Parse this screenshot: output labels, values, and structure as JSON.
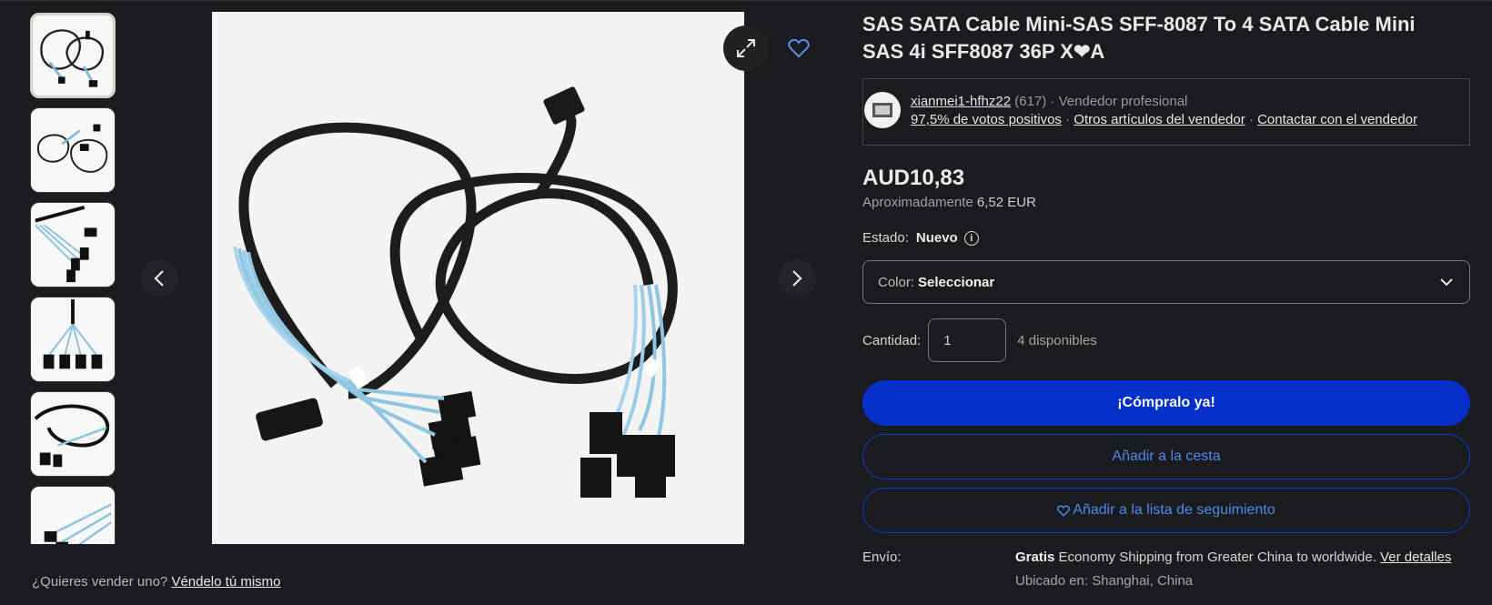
{
  "product": {
    "title": "SAS SATA Cable Mini-SAS SFF-8087 To 4 SATA Cable Mini SAS 4i SFF8087 36P X❤A"
  },
  "seller": {
    "name": "xianmei1-hfhz22",
    "count": "(617)",
    "sep1": "·",
    "type": "Vendedor profesional",
    "feedback": "97,5% de votos positivos",
    "sep2": "·",
    "other_items": "Otros artículos del vendedor",
    "sep3": "·",
    "contact": "Contactar con el vendedor"
  },
  "price": {
    "main": "AUD10,83",
    "approx_label": "Aproximadamente",
    "approx_value": "6,52 EUR"
  },
  "condition": {
    "label": "Estado:",
    "value": "Nuevo",
    "info_icon": "i"
  },
  "color_select": {
    "label": "Color:",
    "value": "Seleccionar"
  },
  "quantity": {
    "label": "Cantidad:",
    "value": "1",
    "available": "4 disponibles"
  },
  "buttons": {
    "buy_now": "¡Cómpralo ya!",
    "add_to_cart": "Añadir a la cesta",
    "watchlist": "Añadir a la lista de seguimiento"
  },
  "shipping": {
    "label": "Envío:",
    "free": "Gratis",
    "method": "Economy Shipping from Greater China to worldwide.",
    "details_link": "Ver detalles",
    "location": "Ubicado en: Shanghai, China"
  },
  "sell_prompt": {
    "question": "¿Quieres vender uno?",
    "link": "Véndelo tú mismo"
  },
  "gallery": {
    "thumbnail_count": 6,
    "active_index": 0
  },
  "icons": {
    "prev": "chevron-left-icon",
    "next": "chevron-right-icon",
    "expand": "expand-icon",
    "favorite": "heart-icon",
    "dropdown": "chevron-down-icon"
  },
  "colors": {
    "background": "#1b1c1f",
    "buy_button": "#0530c9",
    "outline_button": "#0b3fcf",
    "link_blue": "#4f88f0"
  }
}
